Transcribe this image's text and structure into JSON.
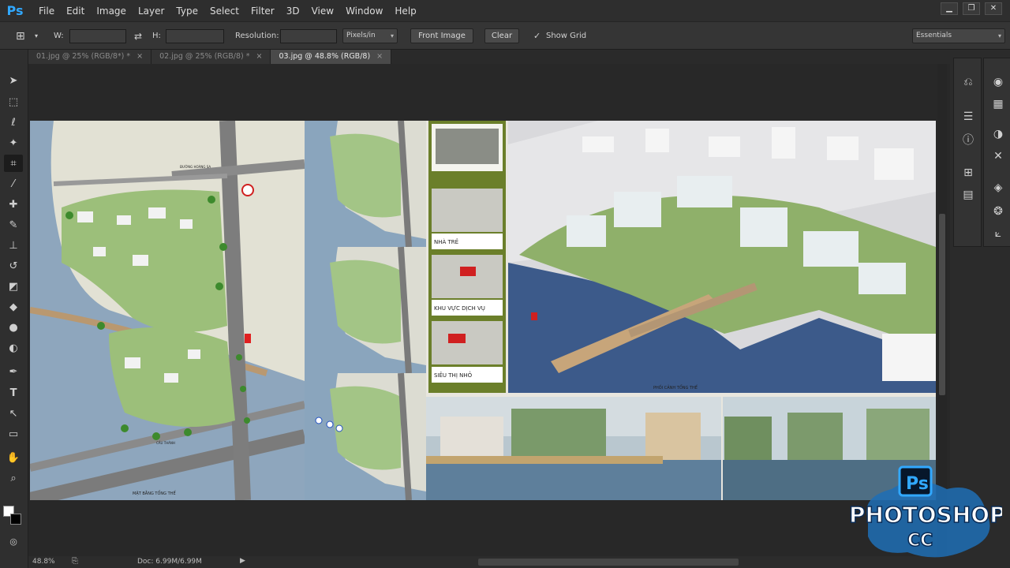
{
  "app": {
    "logo": "Ps"
  },
  "menu": [
    "File",
    "Edit",
    "Image",
    "Layer",
    "Type",
    "Select",
    "Filter",
    "3D",
    "View",
    "Window",
    "Help"
  ],
  "options": {
    "w_label": "W:",
    "h_label": "H:",
    "resolution_label": "Resolution:",
    "units_value": "Pixels/in",
    "front_image": "Front Image",
    "clear": "Clear",
    "show_grid": "Show Grid",
    "workspace": "Essentials"
  },
  "tabs": [
    {
      "label": "01.jpg @ 25% (RGB/8*) *"
    },
    {
      "label": "02.jpg @ 25% (RGB/8) *"
    },
    {
      "label": "03.jpg @ 48.8% (RGB/8)"
    }
  ],
  "status": {
    "zoom": "48.8%",
    "doc": "Doc: 6.99M/6.99M"
  },
  "document": {
    "labels": {
      "site_plan": "MẶT BẰNG TỔNG THỂ",
      "nha_tre": "NHÀ TRẺ",
      "khu_vuc": "KHU VỰC DỊCH VỤ",
      "sieu_thi": "SIÊU THỊ NHỎ",
      "perspective": "PHỐI CẢNH TỔNG THỂ",
      "road_top": "ĐƯỜNG HOÀNG SA",
      "road_bottom": "CẦU THÀNH"
    }
  },
  "watermark": {
    "ps": "Ps",
    "word": "PHOTOSHOP",
    "cc": "CC"
  },
  "colors": {
    "accent": "#31a8ff",
    "panel": "#2f2f2f",
    "canvas_bg": "#282828"
  }
}
